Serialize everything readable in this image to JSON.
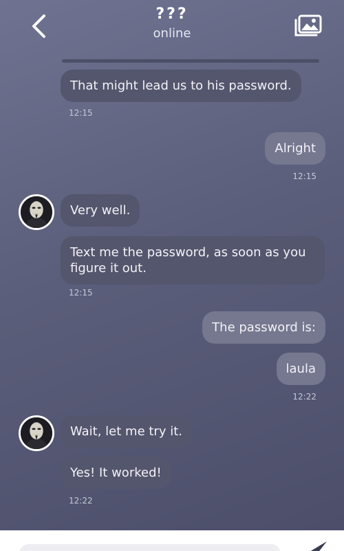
{
  "header": {
    "title": "???",
    "subtitle": "online",
    "back_icon": "chevron-left-icon",
    "gallery_icon": "gallery-icon"
  },
  "messages": [
    {
      "text": "That might lead us to his password.",
      "time": "12:15",
      "direction": "incoming"
    },
    {
      "text": "Alright",
      "time": "12:15",
      "direction": "outgoing"
    },
    {
      "text": "Very well.",
      "direction": "incoming"
    },
    {
      "text": "Text me the password, as soon as you figure it out.",
      "time": "12:15",
      "direction": "incoming"
    },
    {
      "text": "The password is:",
      "direction": "outgoing"
    },
    {
      "text": "laula",
      "time": "12:22",
      "direction": "outgoing"
    },
    {
      "text": "Wait, let me try it.",
      "direction": "incoming"
    },
    {
      "text": "Yes! It worked!",
      "time": "12:22",
      "direction": "incoming"
    }
  ],
  "composer": {
    "placeholder": "",
    "send_icon": "send-icon"
  },
  "colors": {
    "background_top": "#6f7391",
    "background_bottom": "#4b4d69",
    "incoming_bubble": "#54566d",
    "outgoing_bubble": "#75788f"
  }
}
